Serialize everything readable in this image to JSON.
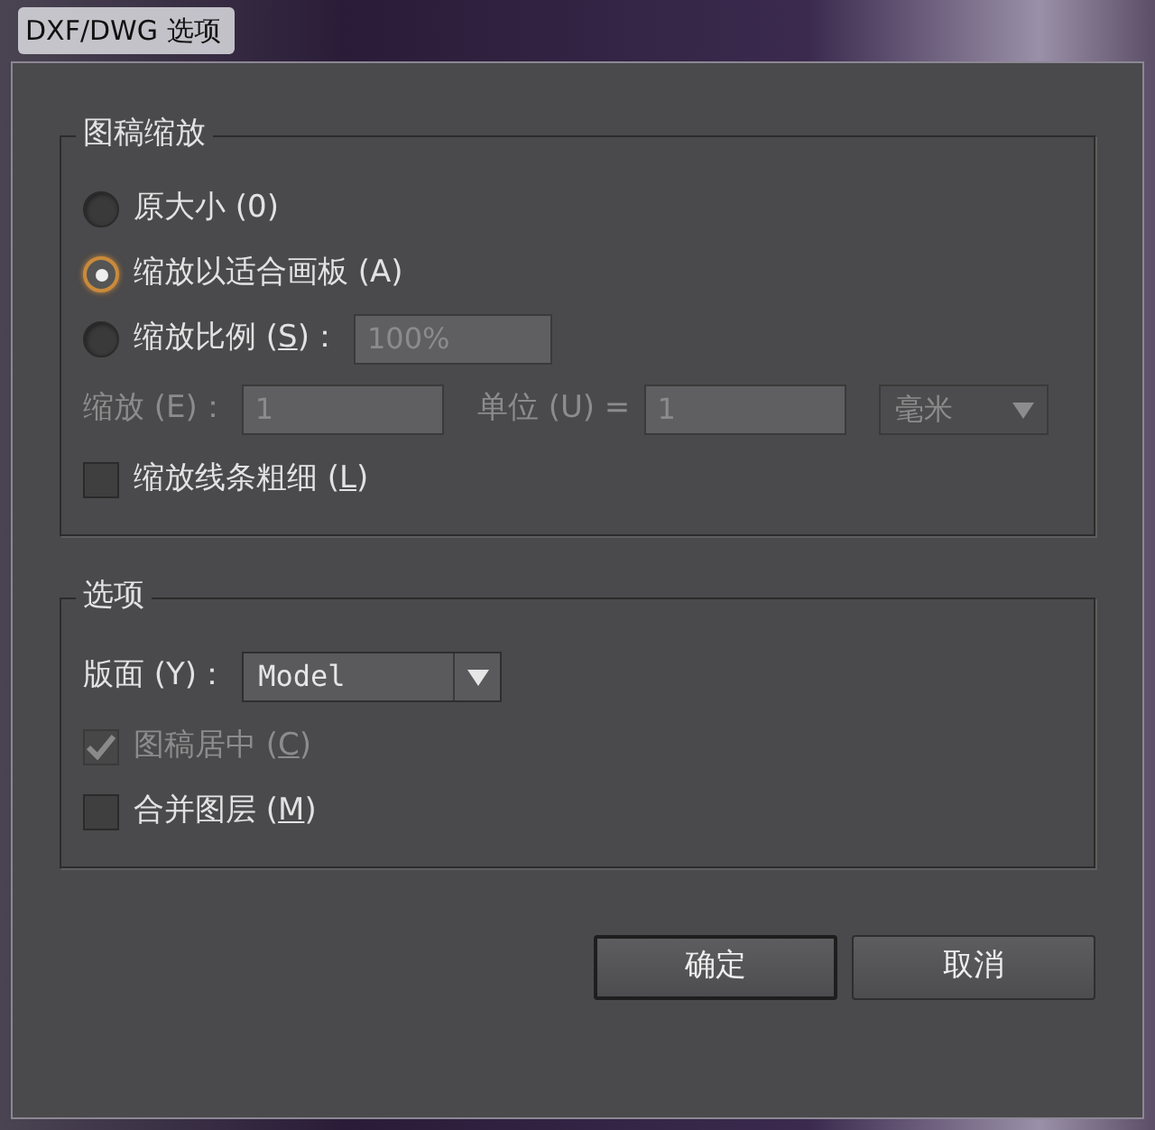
{
  "window": {
    "title": "DXF/DWG 选项"
  },
  "scaling": {
    "legend": "图稿缩放",
    "radios": [
      {
        "before": "原大小 (0)",
        "selected": false
      },
      {
        "before": "缩放以适合画板 (A)",
        "selected": true
      },
      {
        "before": "缩放比例 (",
        "mnemonic": "S",
        "after": ")：",
        "selected": false,
        "field": {
          "value": "100%",
          "disabled": true
        }
      }
    ],
    "scale_row": {
      "scale": {
        "label": "缩放 (E)：",
        "value": "1",
        "disabled": true
      },
      "unit": {
        "label": "单位 (U) =",
        "value": "1",
        "disabled": true
      },
      "unit_select": {
        "value": "毫米",
        "disabled": true
      }
    },
    "checkboxes": [
      {
        "before": "缩放线条粗细 (",
        "mnemonic": "L",
        "after": ")",
        "checked": false,
        "disabled": false
      }
    ]
  },
  "options": {
    "legend": "选项",
    "layout": {
      "label": "版面 (Y)：",
      "value": "Model"
    },
    "checkboxes": [
      {
        "before": "图稿居中 (",
        "mnemonic": "C",
        "after": ")",
        "checked": true,
        "disabled": true
      },
      {
        "before": "合并图层 (",
        "mnemonic": "M",
        "after": ")",
        "checked": false,
        "disabled": false
      }
    ]
  },
  "buttons": [
    {
      "label": "确定",
      "default": true
    },
    {
      "label": "取消",
      "default": false
    }
  ]
}
